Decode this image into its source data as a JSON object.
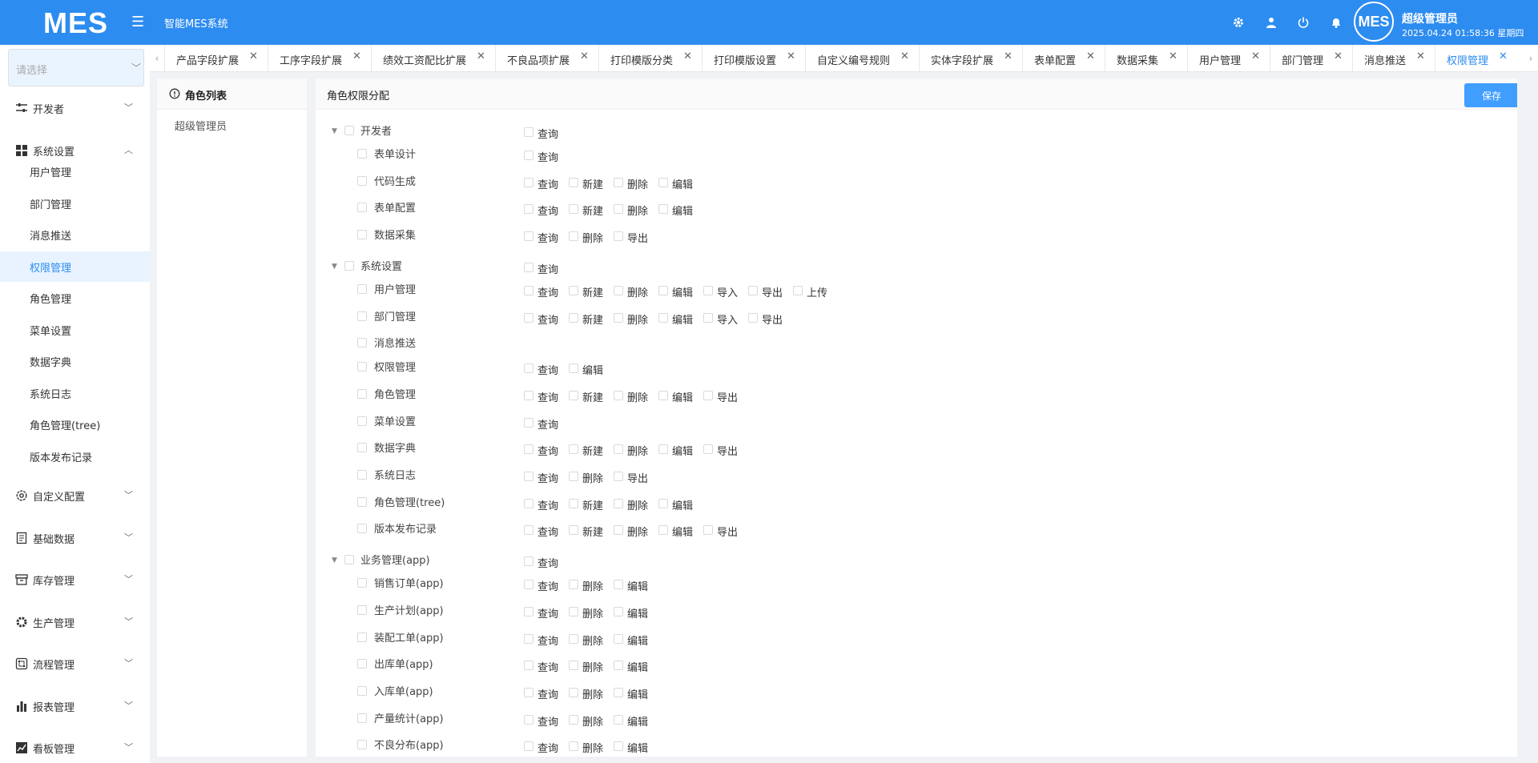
{
  "header": {
    "logo": "MES",
    "system_name": "智能MES系统",
    "username": "超级管理员",
    "datetime": "2025.04.24 01:58:36 星期四",
    "avatar_text": "MES",
    "icons": [
      "gear-icon",
      "user-icon",
      "power-icon",
      "bell-icon"
    ]
  },
  "sidebar": {
    "select_placeholder": "请选择",
    "menus": [
      {
        "label": "开发者",
        "icon": "sliders-icon",
        "expanded": false
      },
      {
        "label": "系统设置",
        "icon": "grid-icon",
        "expanded": true,
        "children": [
          "用户管理",
          "部门管理",
          "消息推送",
          "权限管理",
          "角色管理",
          "菜单设置",
          "数据字典",
          "系统日志",
          "角色管理(tree)",
          "版本发布记录"
        ],
        "active_child": "权限管理"
      },
      {
        "label": "自定义配置",
        "icon": "settings-ring-icon",
        "expanded": false
      },
      {
        "label": "基础数据",
        "icon": "book-icon",
        "expanded": false
      },
      {
        "label": "库存管理",
        "icon": "archive-icon",
        "expanded": false
      },
      {
        "label": "生产管理",
        "icon": "cog-icon",
        "expanded": false
      },
      {
        "label": "流程管理",
        "icon": "flow-icon",
        "expanded": false
      },
      {
        "label": "报表管理",
        "icon": "bar-chart-icon",
        "expanded": false
      },
      {
        "label": "看板管理",
        "icon": "line-chart-icon",
        "expanded": false
      }
    ]
  },
  "tabs": {
    "items": [
      "产品字段扩展",
      "工序字段扩展",
      "绩效工资配比扩展",
      "不良品项扩展",
      "打印模版分类",
      "打印模版设置",
      "自定义编号规则",
      "实体字段扩展",
      "表单配置",
      "数据采集",
      "用户管理",
      "部门管理",
      "消息推送",
      "权限管理"
    ],
    "active": "权限管理"
  },
  "role_panel": {
    "title": "角色列表",
    "roles": [
      "超级管理员"
    ]
  },
  "perm_panel": {
    "title": "角色权限分配",
    "save_label": "保存",
    "groups": [
      {
        "label": "开发者",
        "perms": [
          "查询"
        ],
        "children": [
          {
            "label": "表单设计",
            "perms": [
              "查询"
            ]
          },
          {
            "label": "代码生成",
            "perms": [
              "查询",
              "新建",
              "删除",
              "编辑"
            ]
          },
          {
            "label": "表单配置",
            "perms": [
              "查询",
              "新建",
              "删除",
              "编辑"
            ]
          },
          {
            "label": "数据采集",
            "perms": [
              "查询",
              "删除",
              "导出"
            ]
          }
        ]
      },
      {
        "label": "系统设置",
        "perms": [
          "查询"
        ],
        "children": [
          {
            "label": "用户管理",
            "perms": [
              "查询",
              "新建",
              "删除",
              "编辑",
              "导入",
              "导出",
              "上传"
            ]
          },
          {
            "label": "部门管理",
            "perms": [
              "查询",
              "新建",
              "删除",
              "编辑",
              "导入",
              "导出"
            ]
          },
          {
            "label": "消息推送",
            "perms": []
          },
          {
            "label": "权限管理",
            "perms": [
              "查询",
              "编辑"
            ]
          },
          {
            "label": "角色管理",
            "perms": [
              "查询",
              "新建",
              "删除",
              "编辑",
              "导出"
            ]
          },
          {
            "label": "菜单设置",
            "perms": [
              "查询"
            ]
          },
          {
            "label": "数据字典",
            "perms": [
              "查询",
              "新建",
              "删除",
              "编辑",
              "导出"
            ]
          },
          {
            "label": "系统日志",
            "perms": [
              "查询",
              "删除",
              "导出"
            ]
          },
          {
            "label": "角色管理(tree)",
            "perms": [
              "查询",
              "新建",
              "删除",
              "编辑"
            ]
          },
          {
            "label": "版本发布记录",
            "perms": [
              "查询",
              "新建",
              "删除",
              "编辑",
              "导出"
            ]
          }
        ]
      },
      {
        "label": "业务管理(app)",
        "perms": [
          "查询"
        ],
        "children": [
          {
            "label": "销售订单(app)",
            "perms": [
              "查询",
              "删除",
              "编辑"
            ]
          },
          {
            "label": "生产计划(app)",
            "perms": [
              "查询",
              "删除",
              "编辑"
            ]
          },
          {
            "label": "装配工单(app)",
            "perms": [
              "查询",
              "删除",
              "编辑"
            ]
          },
          {
            "label": "出库单(app)",
            "perms": [
              "查询",
              "删除",
              "编辑"
            ]
          },
          {
            "label": "入库单(app)",
            "perms": [
              "查询",
              "删除",
              "编辑"
            ]
          },
          {
            "label": "产量统计(app)",
            "perms": [
              "查询",
              "删除",
              "编辑"
            ]
          },
          {
            "label": "不良分布(app)",
            "perms": [
              "查询",
              "删除",
              "编辑"
            ]
          }
        ]
      }
    ]
  },
  "colors": {
    "header_bg": "#2d8cf0",
    "accent": "#409eff",
    "active_menu_bg": "#e8f3ff"
  }
}
